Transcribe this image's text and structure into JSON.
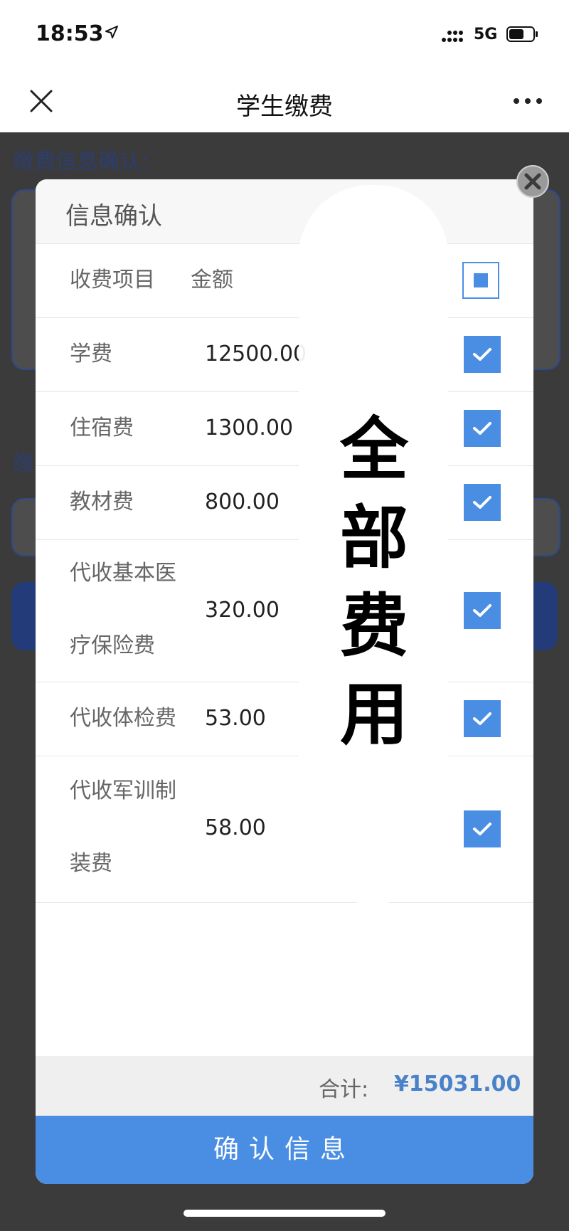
{
  "status_bar": {
    "time": "18:53",
    "network": "5G"
  },
  "nav": {
    "title": "学生缴费"
  },
  "background": {
    "label_top": "缴费信息确认:",
    "label_mid": "缴"
  },
  "modal": {
    "title": "信息确认",
    "header": {
      "item": "收费项目",
      "amount": "金额"
    },
    "rows": [
      {
        "name": "学费",
        "amount": "12500.00",
        "checked": true
      },
      {
        "name": "住宿费",
        "amount": "1300.00",
        "checked": true
      },
      {
        "name": "教材费",
        "amount": "800.00",
        "checked": true
      },
      {
        "name_line1": "代收基本医",
        "name_line2": "疗保险费",
        "amount": "320.00",
        "checked": true
      },
      {
        "name": "代收体检费",
        "amount": "53.00",
        "checked": true
      },
      {
        "name_line1": "代收军训制",
        "name_line2": "装费",
        "amount": "58.00",
        "checked": true
      }
    ],
    "total_label": "合计:",
    "total_value": "¥15031.00",
    "confirm_label": "确认信息"
  },
  "overlay": {
    "text": "全部费用"
  },
  "colors": {
    "accent": "#4a8ee4",
    "total": "#4a82c9"
  }
}
